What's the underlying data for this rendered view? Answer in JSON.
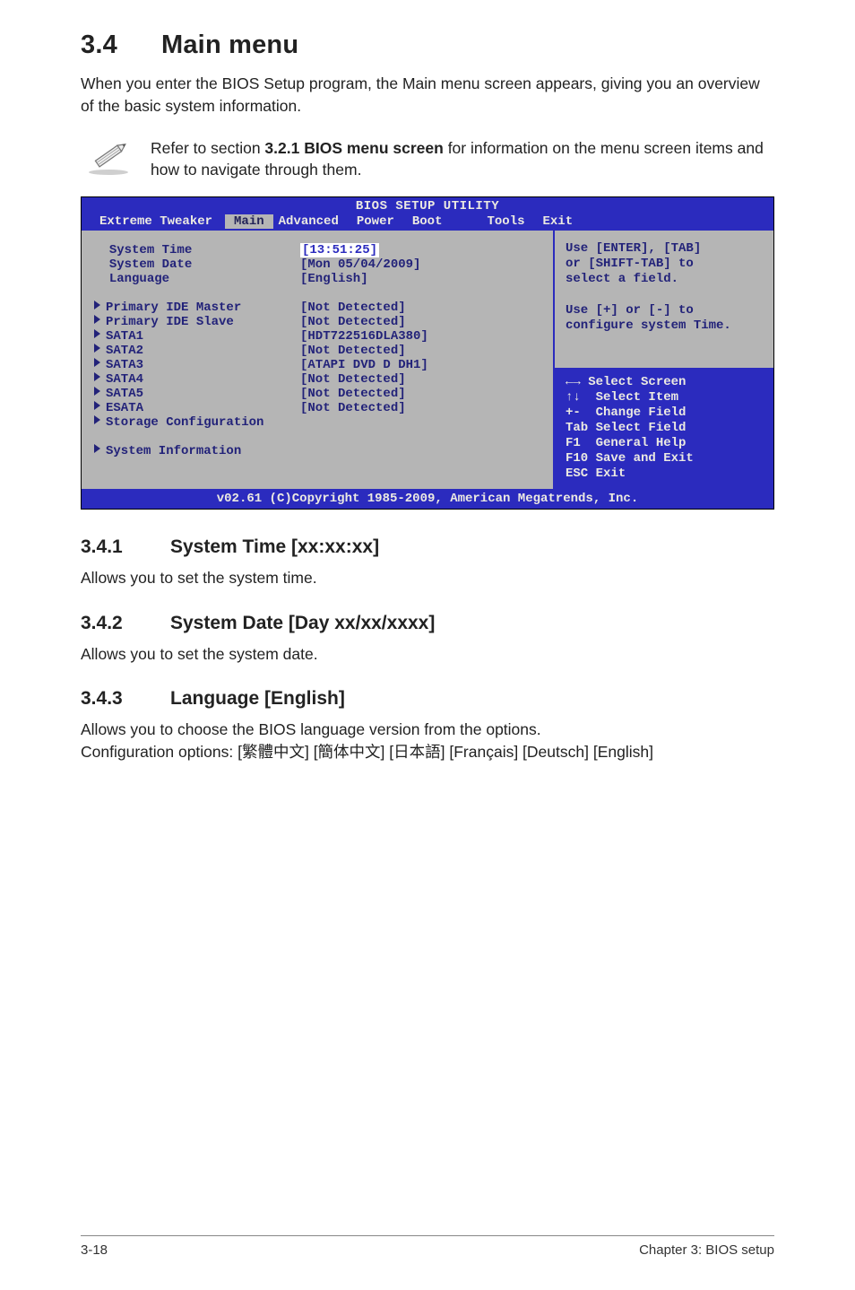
{
  "heading": {
    "number": "3.4",
    "title": "Main menu"
  },
  "intro": "When you enter the BIOS Setup program, the Main menu screen appears, giving you an overview of the basic system information.",
  "note": "Refer to section 3.2.1  BIOS menu screen for information on the menu screen items and how to navigate through them.",
  "note_bold": "3.2.1  BIOS menu screen",
  "bios": {
    "header": "BIOS SETUP UTILITY",
    "tabs": [
      "Extreme Tweaker",
      "Main",
      "Advanced",
      "Power",
      "Boot",
      "Tools",
      "Exit"
    ],
    "active_tab": "Main",
    "left_rows": [
      {
        "label": "System Time",
        "value": "[13:51:25]",
        "tri": false,
        "highlight": true
      },
      {
        "label": "System Date",
        "value": "[Mon 05/04/2009]",
        "tri": false
      },
      {
        "label": "Language",
        "value": "[English]",
        "tri": false
      },
      {
        "label": "",
        "value": "",
        "tri": false
      },
      {
        "label": "Primary IDE Master",
        "value": "[Not Detected]",
        "tri": true
      },
      {
        "label": "Primary IDE Slave",
        "value": "[Not Detected]",
        "tri": true
      },
      {
        "label": "SATA1",
        "value": "[HDT722516DLA380]",
        "tri": true
      },
      {
        "label": "SATA2",
        "value": "[Not Detected]",
        "tri": true
      },
      {
        "label": "SATA3",
        "value": "[ATAPI DVD D DH1]",
        "tri": true
      },
      {
        "label": "SATA4",
        "value": "[Not Detected]",
        "tri": true
      },
      {
        "label": "SATA5",
        "value": "[Not Detected]",
        "tri": true
      },
      {
        "label": "ESATA",
        "value": "[Not Detected]",
        "tri": true
      },
      {
        "label": "Storage Configuration",
        "value": "",
        "tri": true
      },
      {
        "label": "",
        "value": "",
        "tri": false
      },
      {
        "label": "System Information",
        "value": "",
        "tri": true
      }
    ],
    "help_top": "Use [ENTER], [TAB]\nor [SHIFT-TAB] to\nselect a field.\n\nUse [+] or [-] to\nconfigure system Time.",
    "nav": [
      {
        "k": "←→ ",
        "v": "Select Screen"
      },
      {
        "k": "↑↓  ",
        "v": "Select Item"
      },
      {
        "k": "+-  ",
        "v": "Change Field"
      },
      {
        "k": "Tab ",
        "v": "Select Field"
      },
      {
        "k": "F1  ",
        "v": "General Help"
      },
      {
        "k": "F10 ",
        "v": "Save and Exit"
      },
      {
        "k": "ESC ",
        "v": "Exit"
      }
    ],
    "footer": "v02.61 (C)Copyright 1985-2009, American Megatrends, Inc."
  },
  "subs": [
    {
      "num": "3.4.1",
      "title": "System Time [xx:xx:xx]",
      "body": "Allows you to set the system time."
    },
    {
      "num": "3.4.2",
      "title": "System Date [Day xx/xx/xxxx]",
      "body": "Allows you to set the system date."
    },
    {
      "num": "3.4.3",
      "title": "Language [English]",
      "body": "Allows you to choose the BIOS language version from the options.\nConfiguration options: [繁體中文] [簡体中文] [日本語] [Français] [Deutsch] [English]"
    }
  ],
  "footer": {
    "left": "3-18",
    "right": "Chapter 3: BIOS setup"
  }
}
